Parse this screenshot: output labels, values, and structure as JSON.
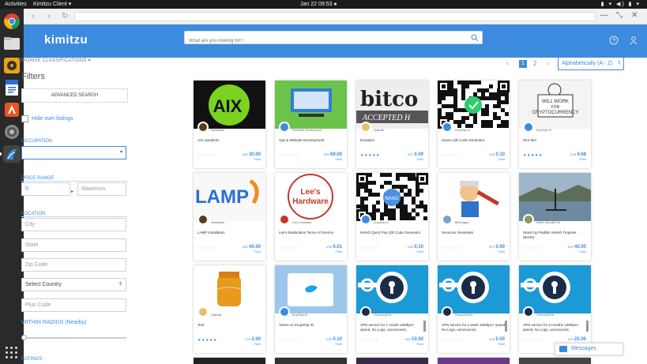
{
  "system": {
    "activities": "Activities",
    "app_name": "Kimitzu Client ▾",
    "clock": "Jan 22  09:53 ●",
    "tray": "▮  ▾  ◀)  ▮  ▾"
  },
  "dock": {
    "items": [
      "chrome-icon",
      "files-icon",
      "rhythmbox-icon",
      "writer-icon",
      "software-icon",
      "settings-icon",
      "kimitzu-icon"
    ]
  },
  "browser": {
    "url": ""
  },
  "header": {
    "logo": "kimitzu",
    "search_placeholder": "What are you looking for?"
  },
  "sidebar": {
    "browse_label": "BROWSE CLASSIFICATIONS ▾",
    "filters_title": "Filters",
    "advanced_search": "ADVANCED SEARCH",
    "hide_own_listings": "Hide own listings",
    "occupation_label": "OCCUPATION",
    "occupation_value": "",
    "price_range_label": "PRICE RANGE",
    "price_min": "0",
    "price_max_placeholder": "Maximum",
    "location_label": "LOCATION",
    "city_placeholder": "City",
    "state_placeholder": "State",
    "zip_placeholder": "Zip Code",
    "country_select": "Select Country",
    "plus_code_placeholder": "Plus Code",
    "within_radius": "WITHIN RADIUS (Nearby)",
    "ratings_label": "RATINGS"
  },
  "pagination": {
    "prev": "‹",
    "pages": [
      "1",
      "2"
    ],
    "next": "›",
    "current": "1"
  },
  "sort": {
    "value": "Alphabetically (A - Z)"
  },
  "listings": [
    {
      "owner": "kiwiaadmin",
      "title": "AIX sysadmin",
      "currency": "SUR",
      "price": "30.00",
      "fixed": "Fixed",
      "stars": "☆☆☆☆☆",
      "rated": false,
      "img": "aix"
    },
    {
      "owner": "SilverStar Development",
      "title": "App & Website Development",
      "currency": "USD",
      "price": "69.00",
      "fixed": "Fixed",
      "stars": "☆☆☆☆☆",
      "rated": false,
      "img": "webdev"
    },
    {
      "owner": "Zijdertikt",
      "title": "Donation",
      "currency": "BTC",
      "price": "0.00",
      "fixed": "Fixed",
      "stars": "★★★★★",
      "rated": true,
      "img": "bitcoin"
    },
    {
      "owner": "DropShip IO",
      "title": "Haven QR Code Generator",
      "currency": "USD",
      "price": "0.10",
      "fixed": "Fixed",
      "stars": "☆☆☆☆☆",
      "rated": false,
      "img": "qr-green"
    },
    {
      "owner": "DropShip IO",
      "title": "Hire Me!",
      "currency": "SUR",
      "price": "4.68",
      "fixed": "Fixed",
      "stars": "★★★★★",
      "rated": true,
      "img": "crypto"
    },
    {
      "owner": "kiwiaadmin",
      "title": "LAMP installation",
      "currency": "SUR",
      "price": "40.00",
      "fixed": "Fixed",
      "stars": "☆☆☆☆☆",
      "rated": false,
      "img": "lamp"
    },
    {
      "owner": "Lee&#x27;s Hardware",
      "title": "Lee's Moderation Terms of Service",
      "currency": "USD",
      "price": "0.01",
      "fixed": "Fixed",
      "stars": "☆☆☆☆☆",
      "rated": false,
      "img": "lees"
    },
    {
      "owner": "DropShip IO",
      "title": "NANO Quick Pay QR Code Generator",
      "currency": "USD",
      "price": "0.10",
      "fixed": "Fixed",
      "stars": "☆☆☆☆☆",
      "rated": false,
      "img": "qr-nano"
    },
    {
      "owner": "BitGangsta",
      "title": "Servicios Generales",
      "currency": "BTC",
      "price": "0.00",
      "fixed": "Fixed",
      "stars": "☆☆☆☆☆",
      "rated": false,
      "img": "plumber"
    },
    {
      "owner": "Weber Mozolter Art",
      "title": "Stand Up Paddle Verleih Tropisee (Berlin)",
      "currency": "SUR",
      "price": "40.00",
      "fixed": "Fixed",
      "stars": "☆☆☆☆☆",
      "rated": false,
      "img": "sup"
    },
    {
      "owner": "Zijdertikt",
      "title": "Test",
      "currency": "USD",
      "price": "2.00",
      "fixed": "Fixed",
      "stars": "★★★★★",
      "rated": true,
      "img": "honey"
    },
    {
      "owner": "DropShip IO",
      "title": "Tweet on DropShip IO",
      "currency": "USD",
      "price": "0.10",
      "fixed": "Fixed",
      "stars": "☆☆☆☆☆",
      "rated": false,
      "img": "tweet"
    },
    {
      "owner": "ChemobylVHe",
      "title": "VPN service for 1 month 10Mbps+ speed, No Logs, uncensored,",
      "currency": "SUR",
      "price": "10.00",
      "fixed": "Fixed",
      "stars": "☆☆☆☆☆",
      "rated": false,
      "img": "vpn"
    },
    {
      "owner": "ChemobylVHe",
      "title": "VPN service for 1 week 10Mbps+ speed, No Logs, uncensored,",
      "currency": "SUR",
      "price": "5.00",
      "fixed": "Fixed",
      "stars": "☆☆☆☆☆",
      "rated": false,
      "img": "vpn"
    },
    {
      "owner": "ChemobylVHe",
      "title": "VPN service for 3 months 10Mbps+ speed, No Logs, uncensored,",
      "currency": "SUR",
      "price": "25.00",
      "fixed": "Fixed",
      "stars": "☆☆☆☆☆",
      "rated": false,
      "img": "vpn"
    }
  ],
  "messages": {
    "label": "Messages"
  },
  "colors": {
    "brand": "#3d8bdf",
    "dock": "#2a2a2a",
    "topbar": "#1b1b1b"
  }
}
